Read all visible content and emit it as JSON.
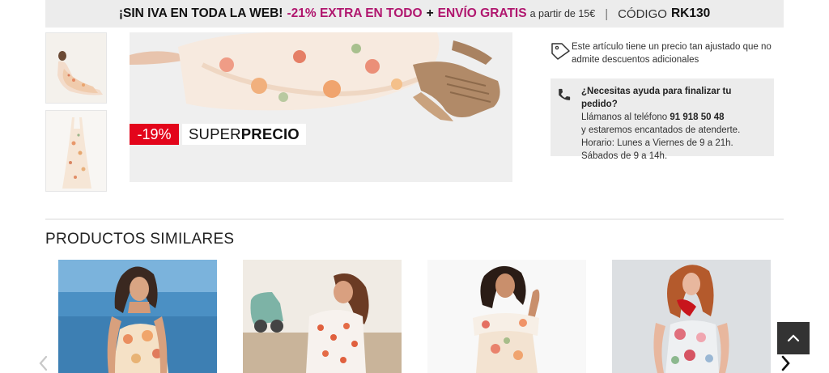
{
  "promo": {
    "part1": "¡SIN IVA EN TODA LA WEB!",
    "part2": "-21% EXTRA EN TODO",
    "plus": "+",
    "part3": "ENVÍO GRATIS",
    "part4": "a partir de 15€",
    "separator": "|",
    "code_label": "CÓDIGO",
    "code_value": "RK130"
  },
  "product": {
    "discount": "-19%",
    "badge_normal": "SUPER",
    "badge_bold": "PRECIO"
  },
  "price_note": {
    "line1": "Este artículo tiene un precio tan ajustado que no",
    "line2": "admite descuentos adicionales",
    "icon": "price-tag-icon"
  },
  "help": {
    "title": "¿Necesitas ayuda para finalizar tu pedido?",
    "line1_prefix": "Llámanos al teléfono",
    "phone": "91 918 50 48",
    "line2": "y estaremos encantados de atenderte.",
    "line3": "Horario: Lunes a Viernes de 9 a 21h.",
    "line4": "Sábados de 9 a 14h.",
    "icon": "phone-icon"
  },
  "similar": {
    "title": "PRODUCTOS SIMILARES"
  },
  "colors": {
    "promo_bg": "#ececec",
    "magenta": "#b0166e",
    "discount_red": "#e3051b",
    "scroll_top_bg": "#333333"
  }
}
